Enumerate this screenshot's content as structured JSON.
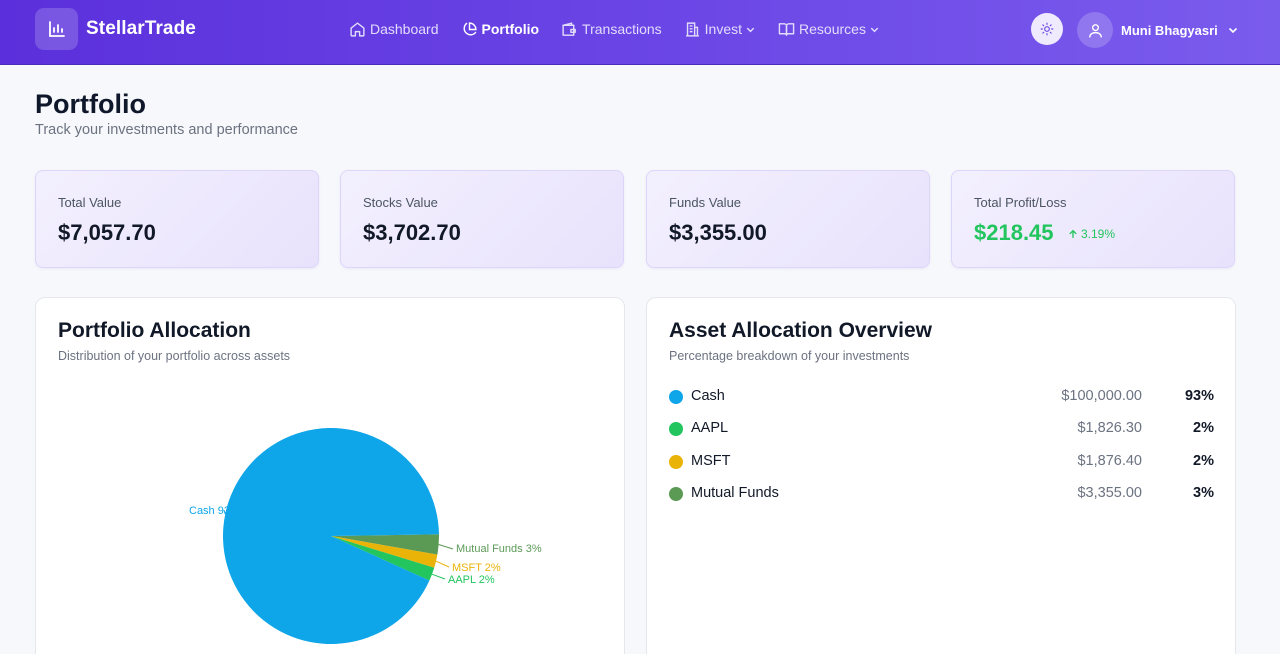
{
  "brand": {
    "name": "StellarTrade"
  },
  "nav": {
    "dashboard": "Dashboard",
    "portfolio": "Portfolio",
    "transactions": "Transactions",
    "invest": "Invest",
    "resources": "Resources"
  },
  "user": {
    "name": "Muni Bhagyasri"
  },
  "page": {
    "title": "Portfolio",
    "subtitle": "Track your investments and performance"
  },
  "stats": [
    {
      "label": "Total Value",
      "value": "$7,057.70"
    },
    {
      "label": "Stocks Value",
      "value": "$3,702.70"
    },
    {
      "label": "Funds Value",
      "value": "$3,355.00"
    },
    {
      "label": "Total Profit/Loss",
      "value": "$218.45",
      "change": "3.19%"
    }
  ],
  "allocation_panel": {
    "title": "Portfolio Allocation",
    "subtitle": "Distribution of your portfolio across assets"
  },
  "overview_panel": {
    "title": "Asset Allocation Overview",
    "subtitle": "Percentage breakdown of your investments",
    "rows": [
      {
        "name": "Cash",
        "amount": "$100,000.00",
        "percent": "93%",
        "color": "#0ea5e9"
      },
      {
        "name": "AAPL",
        "amount": "$1,826.30",
        "percent": "2%",
        "color": "#22c55e"
      },
      {
        "name": "MSFT",
        "amount": "$1,876.40",
        "percent": "2%",
        "color": "#eab308"
      },
      {
        "name": "Mutual Funds",
        "amount": "$3,355.00",
        "percent": "3%",
        "color": "#5b9a55"
      }
    ]
  },
  "chart_data": {
    "type": "pie",
    "slices": [
      {
        "name": "Cash",
        "value": 93,
        "label": "Cash 93%",
        "color": "#0ea5e9"
      },
      {
        "name": "AAPL",
        "value": 2,
        "label": "AAPL 2%",
        "color": "#22c55e"
      },
      {
        "name": "MSFT",
        "value": 2,
        "label": "MSFT 2%",
        "color": "#eab308"
      },
      {
        "name": "Mutual Funds",
        "value": 3,
        "label": "Mutual Funds 3%",
        "color": "#5b9a55"
      }
    ]
  }
}
